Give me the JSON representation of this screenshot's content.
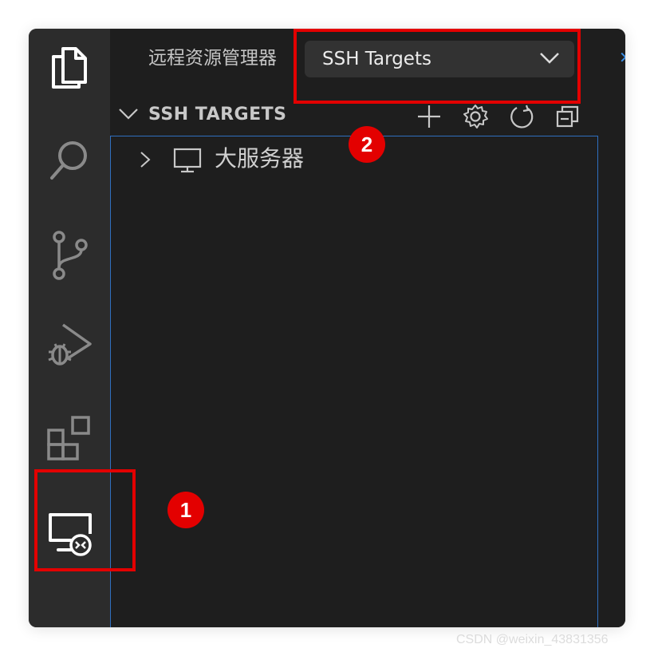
{
  "activity_bar": {
    "items": [
      {
        "icon": "explorer-files-icon",
        "active": true
      },
      {
        "icon": "search-icon"
      },
      {
        "icon": "source-control-icon"
      },
      {
        "icon": "run-debug-icon"
      },
      {
        "icon": "extensions-icon"
      },
      {
        "icon": "remote-explorer-icon",
        "active": true
      }
    ]
  },
  "sidebar": {
    "title": "远程资源管理器",
    "dropdown": {
      "selected": "SSH Targets"
    },
    "section": {
      "title": "SSH TARGETS",
      "actions": [
        {
          "icon": "add-icon"
        },
        {
          "icon": "gear-icon"
        },
        {
          "icon": "refresh-icon"
        },
        {
          "icon": "collapse-all-icon"
        }
      ]
    },
    "tree": {
      "items": [
        {
          "label": "大服务器",
          "icon": "monitor-icon",
          "expanded": false
        }
      ]
    }
  },
  "annotations": {
    "badge_1": "1",
    "badge_2": "2",
    "color": "#e30000"
  },
  "watermark": "CSDN @weixin_43831356",
  "colors": {
    "activity_bar_bg": "#2c2c2c",
    "sidebar_bg": "#1e1e1e",
    "focus_border": "#2f6fbf"
  }
}
